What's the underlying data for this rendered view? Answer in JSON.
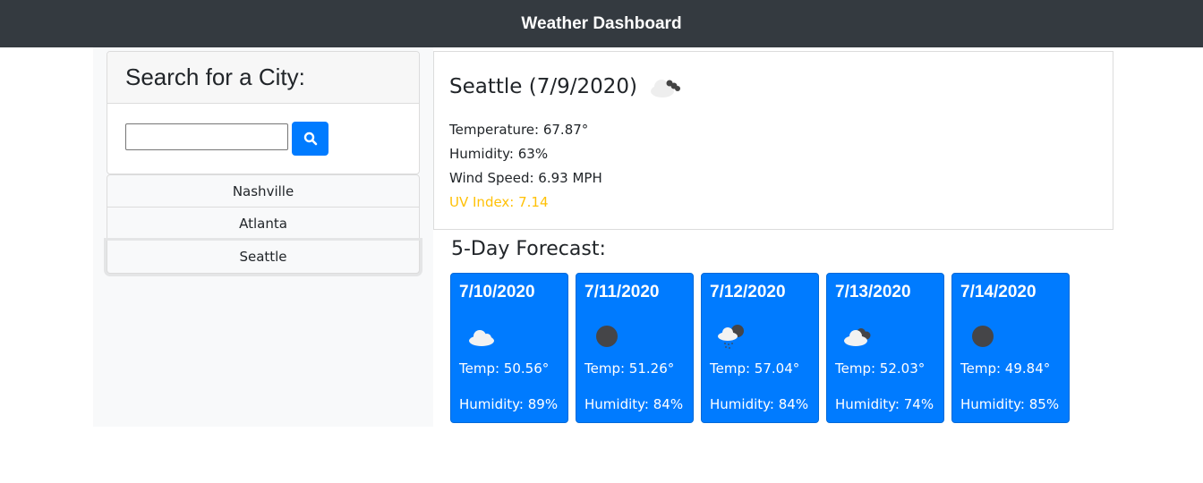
{
  "header": {
    "title": "Weather Dashboard"
  },
  "search": {
    "title": "Search for a City:",
    "input_value": "",
    "button_icon": "search-icon"
  },
  "history": [
    {
      "label": "Nashville",
      "active": false
    },
    {
      "label": "Atlanta",
      "active": false
    },
    {
      "label": "Seattle",
      "active": true
    }
  ],
  "current": {
    "title": "Seattle (7/9/2020)",
    "icon": "broken-clouds-icon",
    "temperature": "Temperature: 67.87°",
    "humidity": "Humidity: 63%",
    "wind": "Wind Speed: 6.93 MPH",
    "uv": "UV Index: 7.14"
  },
  "forecast": {
    "title": "5-Day Forecast:",
    "days": [
      {
        "date": "7/10/2020",
        "icon": "few-clouds-icon",
        "temp": "Temp: 50.56°",
        "humidity": "Humidity: 89%"
      },
      {
        "date": "7/11/2020",
        "icon": "clear-night-icon",
        "temp": "Temp: 51.26°",
        "humidity": "Humidity: 84%"
      },
      {
        "date": "7/12/2020",
        "icon": "rain-night-icon",
        "temp": "Temp: 57.04°",
        "humidity": "Humidity: 84%"
      },
      {
        "date": "7/13/2020",
        "icon": "broken-clouds-icon",
        "temp": "Temp: 52.03°",
        "humidity": "Humidity: 74%"
      },
      {
        "date": "7/14/2020",
        "icon": "clear-night-icon",
        "temp": "Temp: 49.84°",
        "humidity": "Humidity: 85%"
      }
    ]
  },
  "colors": {
    "navbar": "#343a40",
    "primary": "#007bff",
    "uv_warning": "#ffc107"
  }
}
